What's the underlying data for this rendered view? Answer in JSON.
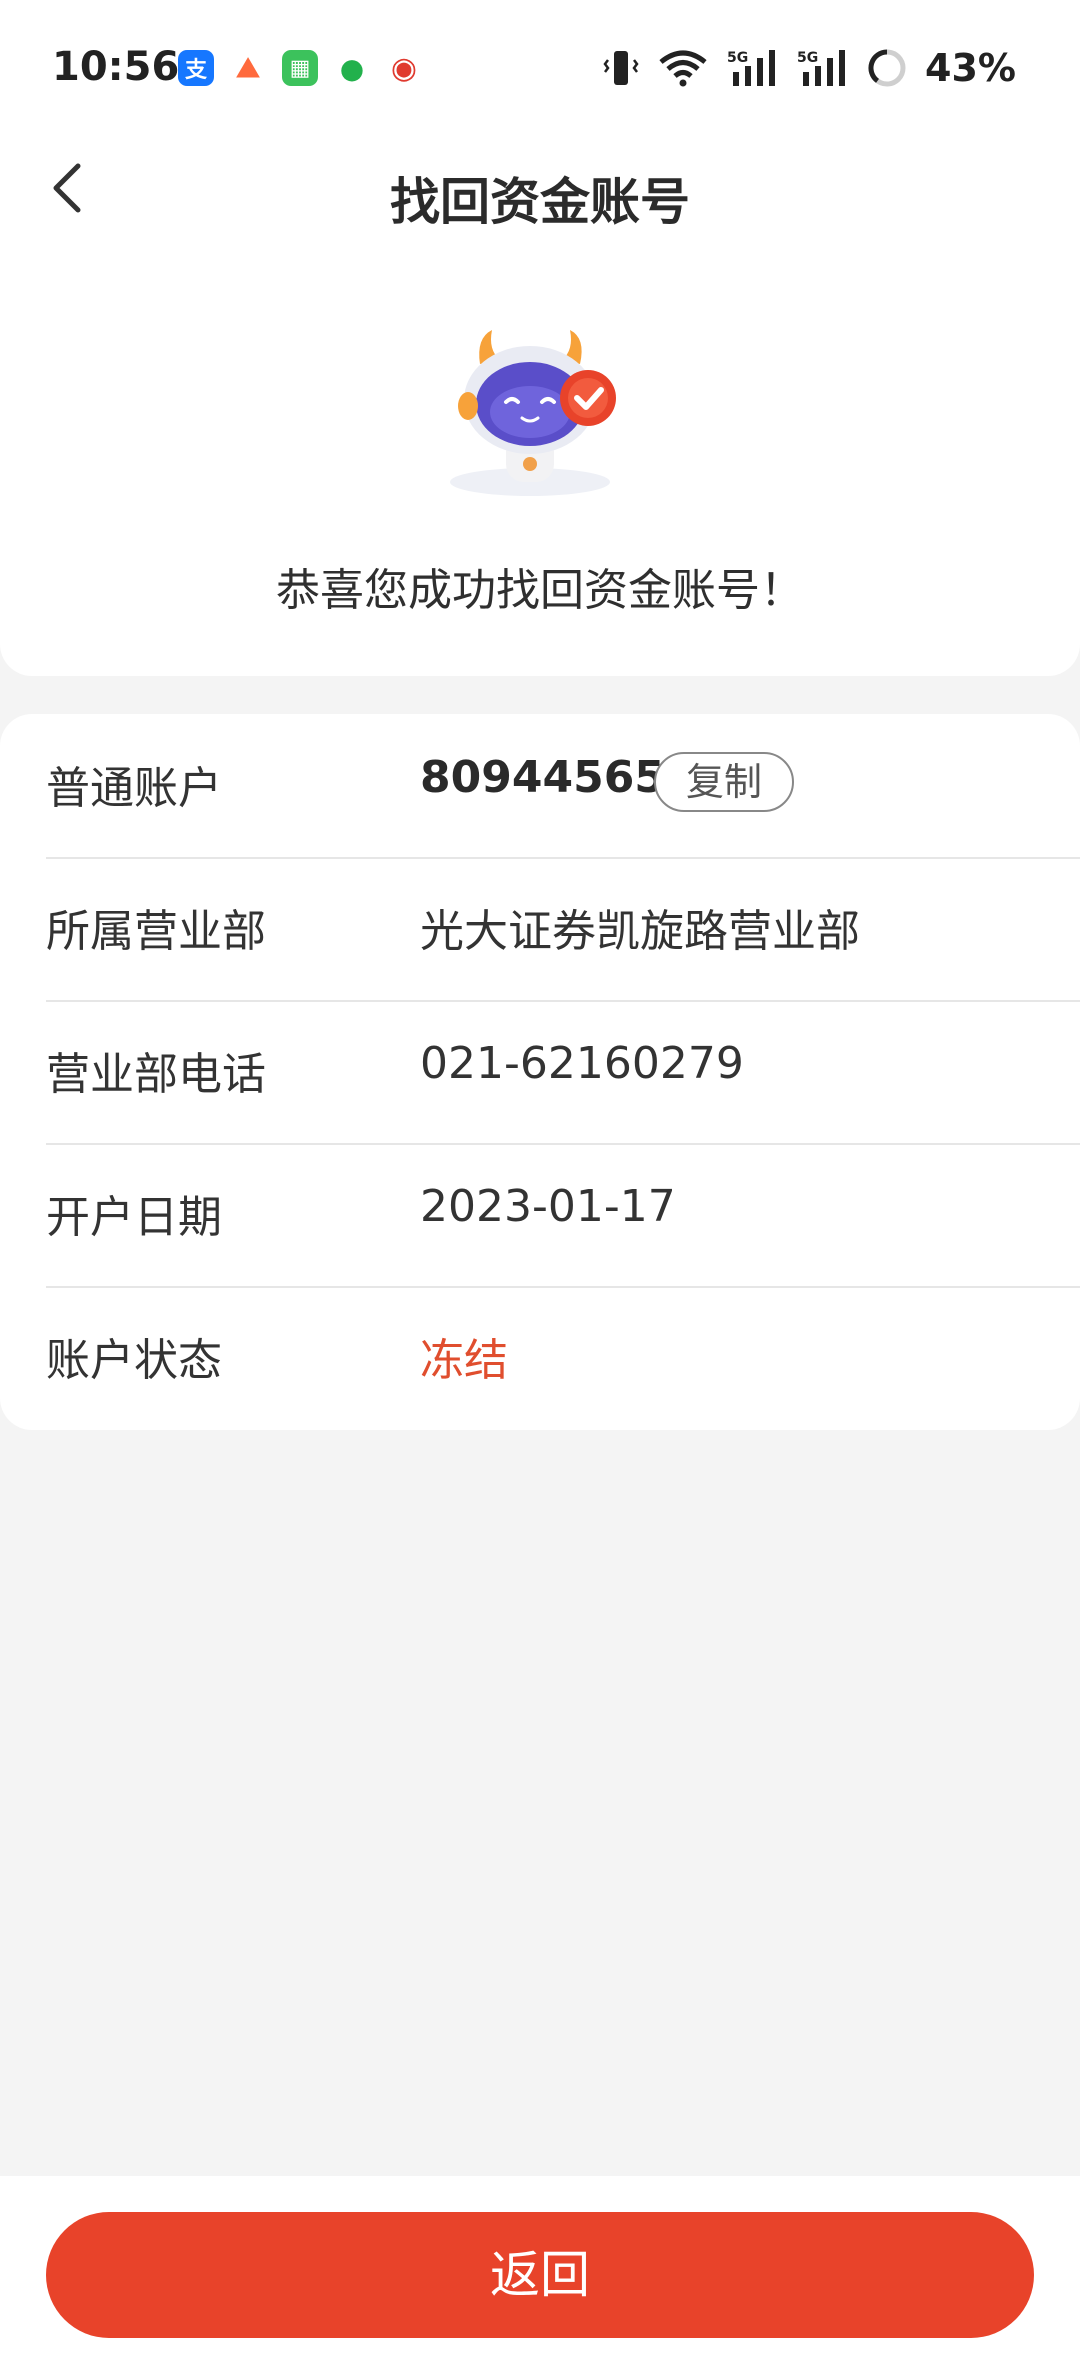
{
  "status_bar": {
    "time": "10:56",
    "app_icons": [
      {
        "name": "alipay-icon",
        "glyph": "支",
        "color": "#1677ff"
      },
      {
        "name": "game-icon",
        "glyph": "⛰",
        "color": "#ff6a3d"
      },
      {
        "name": "grid-app-icon",
        "glyph": "▦",
        "color": "#3cc25c"
      },
      {
        "name": "chat-icon",
        "glyph": "●",
        "color": "#22b14c"
      },
      {
        "name": "china-mobile-icon",
        "glyph": "◉",
        "color": "#e03a2f"
      }
    ],
    "battery": "43%"
  },
  "nav": {
    "title": "找回资金账号"
  },
  "hero": {
    "message": "恭喜您成功找回资金账号！"
  },
  "info": {
    "rows": [
      {
        "label": "普通账户",
        "value": "80944565",
        "copy": "复制"
      },
      {
        "label": "所属营业部",
        "value": "光大证券凯旋路营业部"
      },
      {
        "label": "营业部电话",
        "value": "021-62160279"
      },
      {
        "label": "开户日期",
        "value": "2023-01-17"
      },
      {
        "label": "账户状态",
        "value": "冻结"
      }
    ]
  },
  "footer": {
    "return_label": "返回"
  },
  "colors": {
    "accent": "#e8432a",
    "status_frozen": "#e04e2e"
  }
}
